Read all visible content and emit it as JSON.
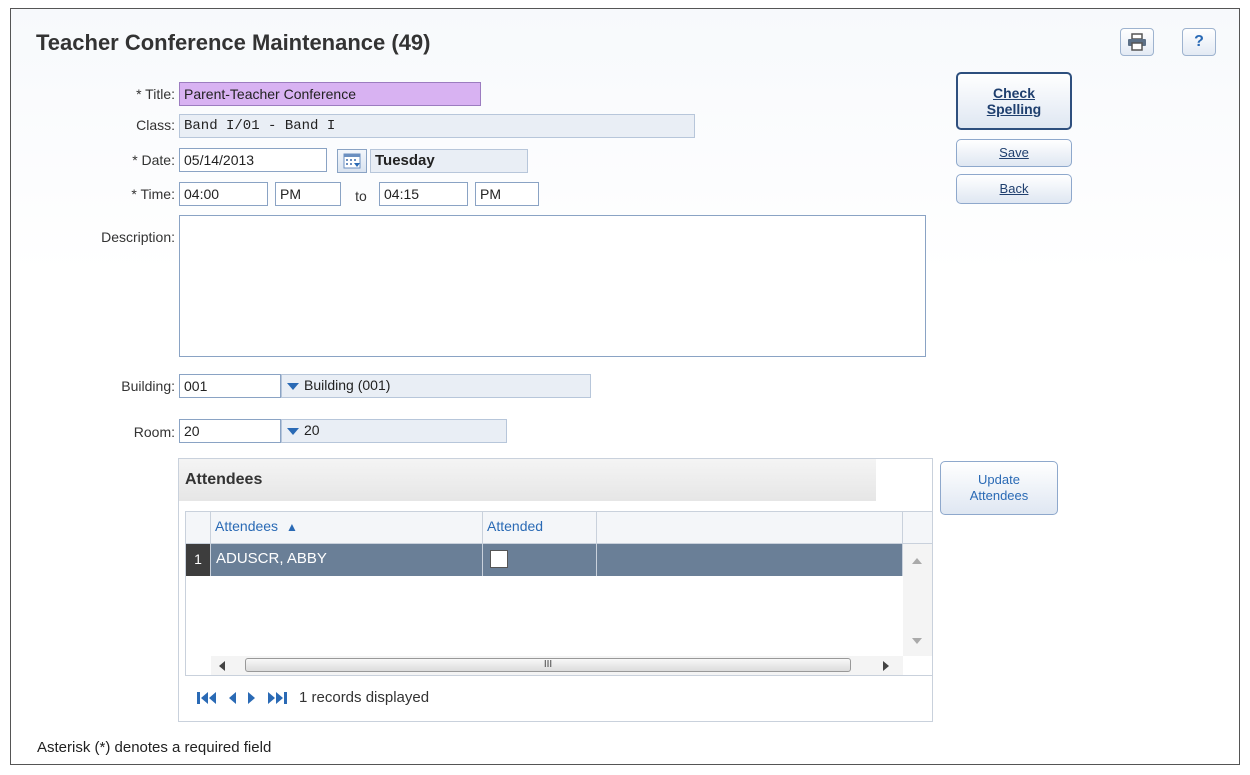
{
  "page": {
    "title": "Teacher Conference Maintenance (49)"
  },
  "toolbar": {
    "print_icon": "print-icon",
    "help_label": "?"
  },
  "form": {
    "title_label": "* Title:",
    "title_value": "Parent-Teacher Conference",
    "class_label": "Class:",
    "class_value": "Band I/01 - Band I",
    "date_label": "* Date:",
    "date_value": "05/14/2013",
    "day_value": "Tuesday",
    "time_label": "* Time:",
    "time_from": "04:00",
    "time_from_ampm": "PM",
    "to_label": "to",
    "time_to": "04:15",
    "time_to_ampm": "PM",
    "description_label": "Description:",
    "description_value": "",
    "building_label": "Building:",
    "building_code": "001",
    "building_name": "Building (001)",
    "room_label": "Room:",
    "room_code": "20",
    "room_name": "20"
  },
  "actions": {
    "check_spelling_line1": "Check",
    "check_spelling_line2": "Spelling",
    "save_label": "Save",
    "back_label": "Back",
    "update_line1": "Update",
    "update_line2": "Attendees"
  },
  "attendees": {
    "panel_title": "Attendees",
    "columns": {
      "name": "Attendees",
      "sort_indicator": "▲",
      "attended": "Attended"
    },
    "rows": [
      {
        "index": "1",
        "name": "ADUSCR, ABBY",
        "attended": false
      }
    ],
    "records_text": "1 records displayed",
    "scroll_mark": "III"
  },
  "footer": {
    "note": "Asterisk (*) denotes a required field"
  },
  "colors": {
    "title_highlight": "#d8b2f2",
    "selected_row": "#6a7f97",
    "link_blue": "#2a6ab5"
  }
}
